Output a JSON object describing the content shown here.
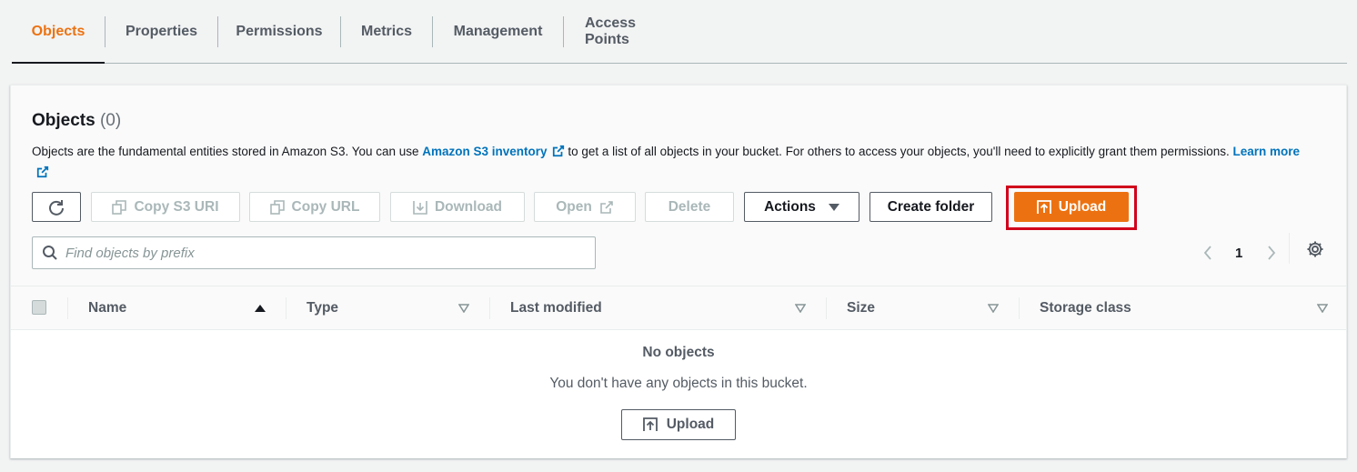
{
  "tabs": [
    {
      "label": "Objects",
      "active": true
    },
    {
      "label": "Properties"
    },
    {
      "label": "Permissions"
    },
    {
      "label": "Metrics"
    },
    {
      "label": "Management"
    },
    {
      "label": "Access Points"
    }
  ],
  "panel": {
    "title": "Objects",
    "count": "(0)",
    "desc_part1": "Objects are the fundamental entities stored in Amazon S3. You can use ",
    "inventory_link": "Amazon S3 inventory",
    "desc_part2": " to get a list of all objects in your bucket. For others to access your objects, you'll need to explicitly grant them permissions. ",
    "learn_more": "Learn more"
  },
  "toolbar": {
    "refresh_icon": "refresh-icon",
    "copy_s3_uri": "Copy S3 URI",
    "copy_url": "Copy URL",
    "download": "Download",
    "open": "Open",
    "delete": "Delete",
    "actions": "Actions",
    "create_folder": "Create folder",
    "upload": "Upload"
  },
  "search": {
    "placeholder": "Find objects by prefix",
    "value": ""
  },
  "pagination": {
    "current_page": "1"
  },
  "table": {
    "columns": [
      "Name",
      "Type",
      "Last modified",
      "Size",
      "Storage class"
    ],
    "empty_title": "No objects",
    "empty_desc": "You don't have any objects in this bucket.",
    "empty_upload": "Upload"
  },
  "colors": {
    "accent": "#ec7211",
    "link": "#0073bb",
    "highlight": "#d0021b"
  }
}
